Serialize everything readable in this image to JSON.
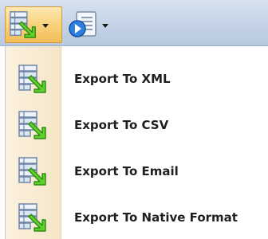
{
  "toolbar": {
    "export_button": {
      "icon": "export-data-icon",
      "has_dropdown": true
    },
    "report_button": {
      "icon": "report-play-icon",
      "has_dropdown": true
    }
  },
  "menu": {
    "items": [
      {
        "label": "Export To XML",
        "icon": "export-data-icon"
      },
      {
        "label": "Export To CSV",
        "icon": "export-data-icon"
      },
      {
        "label": "Export To Email",
        "icon": "export-data-icon"
      },
      {
        "label": "Export To Native Format",
        "icon": "export-data-icon"
      }
    ]
  },
  "colors": {
    "toolbar_bg": "#c4d3e6",
    "active_button_bg": "#f8d27c",
    "menu_gutter_bg": "#f6e6c8",
    "text": "#1f1f1f"
  }
}
